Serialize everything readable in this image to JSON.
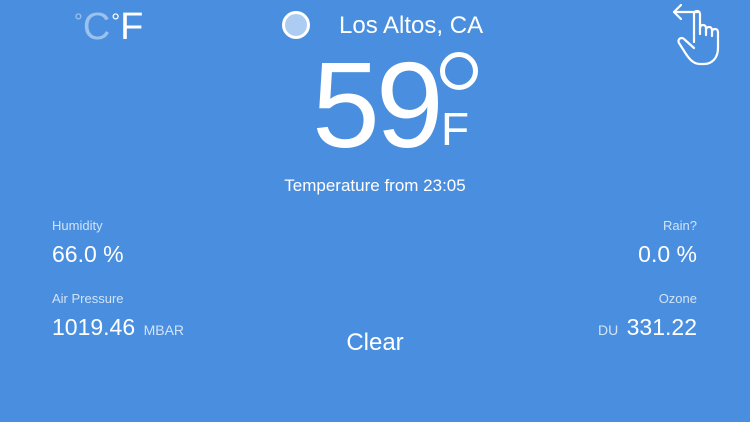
{
  "units": {
    "celsius_label": "C",
    "fahrenheit_label": "F",
    "degree_symbol": "°",
    "active": "F"
  },
  "location": {
    "name": "Los Altos, CA"
  },
  "temperature": {
    "value": "59",
    "unit": "F",
    "source_text": "Temperature from 23:05"
  },
  "metrics": {
    "humidity": {
      "label": "Humidity",
      "value": "66.0 %"
    },
    "rain": {
      "label": "Rain?",
      "value": "0.0 %"
    },
    "air_pressure": {
      "label": "Air Pressure",
      "value": "1019.46",
      "unit": "MBAR"
    },
    "ozone": {
      "label": "Ozone",
      "value": "331.22",
      "unit": "DU"
    }
  },
  "condition": "Clear",
  "colors": {
    "background": "#4a8fdf",
    "foreground": "#ffffff"
  },
  "icons": {
    "location": "location-dot-icon",
    "gesture": "swipe-hand-icon"
  }
}
